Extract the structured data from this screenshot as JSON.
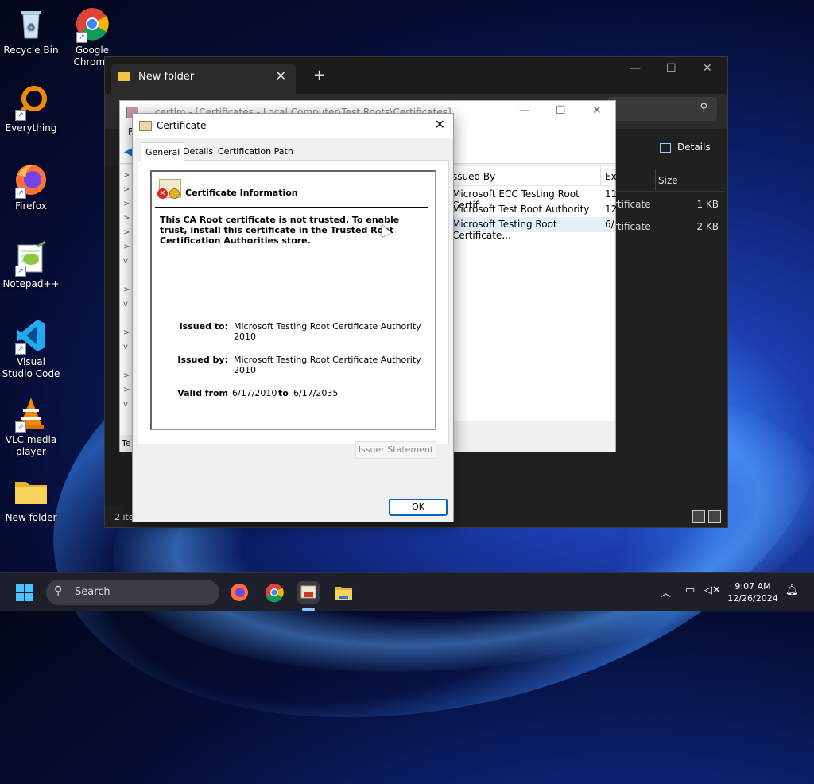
{
  "desktop": {
    "icons": [
      {
        "label": "Recycle Bin"
      },
      {
        "label": "Google Chrome"
      },
      {
        "label": "Everything"
      },
      {
        "label": "Firefox"
      },
      {
        "label": "Notepad++"
      },
      {
        "label": "Visual Studio Code"
      },
      {
        "label": "VLC media player"
      },
      {
        "label": "New folder"
      }
    ]
  },
  "explorer": {
    "tab_title": "New folder",
    "close_glyph": "✕",
    "add_tab_glyph": "+",
    "details_label": "Details",
    "columns": {
      "type": "Ex",
      "size": "Size"
    },
    "rows": [
      {
        "type": "rtificate",
        "size": "1 KB"
      },
      {
        "type": "rtificate",
        "size": "2 KB"
      }
    ],
    "status": "2 ite"
  },
  "certlm": {
    "title": "certlm - [Certificates - Local Computer\\Test Roots\\Certificates]",
    "menu_first": "F",
    "columns": {
      "issued_by": "ssued By",
      "expires": "Ex"
    },
    "rows": [
      {
        "issued_by": "Microsoft ECC Testing Root Certif...",
        "expires": "11"
      },
      {
        "issued_by": "Microsoft Test Root Authority",
        "expires": "12"
      },
      {
        "issued_by": "Microsoft Testing Root Certificate...",
        "expires": "6/"
      }
    ],
    "status": "Te"
  },
  "dialog": {
    "title": "Certificate",
    "close_glyph": "✕",
    "tabs": [
      "General",
      "Details",
      "Certification Path"
    ],
    "info_heading": "Certificate Information",
    "warning": "This CA Root certificate is not trusted. To enable trust, install this certificate in the Trusted Root Certification Authorities store.",
    "issued_to_label": "Issued to:",
    "issued_to": "Microsoft Testing Root Certificate Authority 2010",
    "issued_by_label": "Issued by:",
    "issued_by": "Microsoft Testing Root Certificate Authority 2010",
    "valid_from_label": "Valid from",
    "valid_from": "6/17/2010",
    "to_label": "to",
    "valid_to": "6/17/2035",
    "issuer_statement": "Issuer Statement",
    "ok": "OK"
  },
  "taskbar": {
    "search_placeholder": "Search",
    "time": "9:07 AM",
    "date": "12/26/2024"
  },
  "colors": {
    "accent": "#0067c0",
    "taskbar": "#1d1f2b",
    "explorer_bg": "#202020",
    "error_red": "#dd2222"
  }
}
